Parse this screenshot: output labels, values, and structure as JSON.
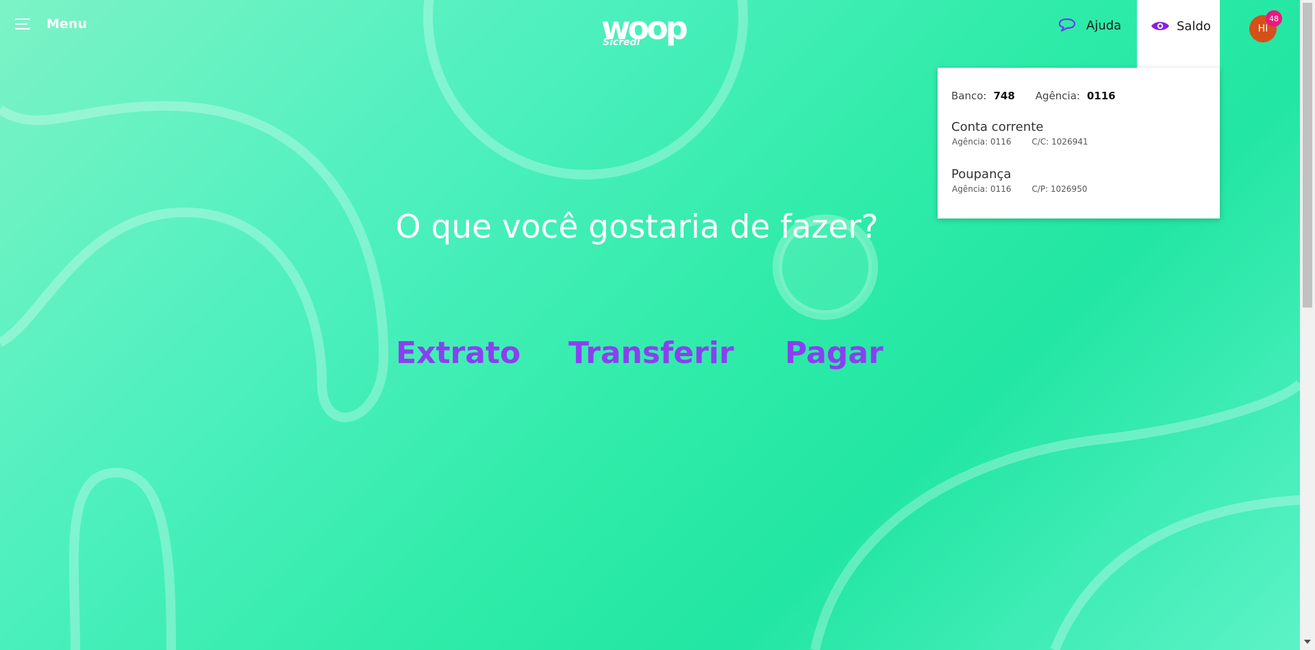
{
  "colors": {
    "accent_purple": "#8b3ff2",
    "avatar_bg": "#d4521a",
    "badge_bg": "#e8197f",
    "background_green": "#2eeba8"
  },
  "header": {
    "menu_label": "Menu",
    "logo_word": "woop",
    "logo_sub": "Sicredi",
    "help_label": "Ajuda",
    "balance_label": "Saldo",
    "avatar_initials": "HI",
    "notification_count": "48"
  },
  "balance_dropdown": {
    "bank_label": "Banco:",
    "bank_value": "748",
    "agency_label": "Agência:",
    "agency_value": "0116",
    "accounts": [
      {
        "title": "Conta corrente",
        "agency": "Agência: 0116",
        "number": "C/C: 1026941"
      },
      {
        "title": "Poupança",
        "agency": "Agência: 0116",
        "number": "C/P: 1026950"
      }
    ]
  },
  "main": {
    "question": "O que você gostaria de fazer?",
    "actions": [
      "Extrato",
      "Transferir",
      "Pagar"
    ]
  },
  "icons": {
    "menu": "hamburger-icon",
    "help": "chat-bubble-icon",
    "balance": "eye-icon"
  }
}
